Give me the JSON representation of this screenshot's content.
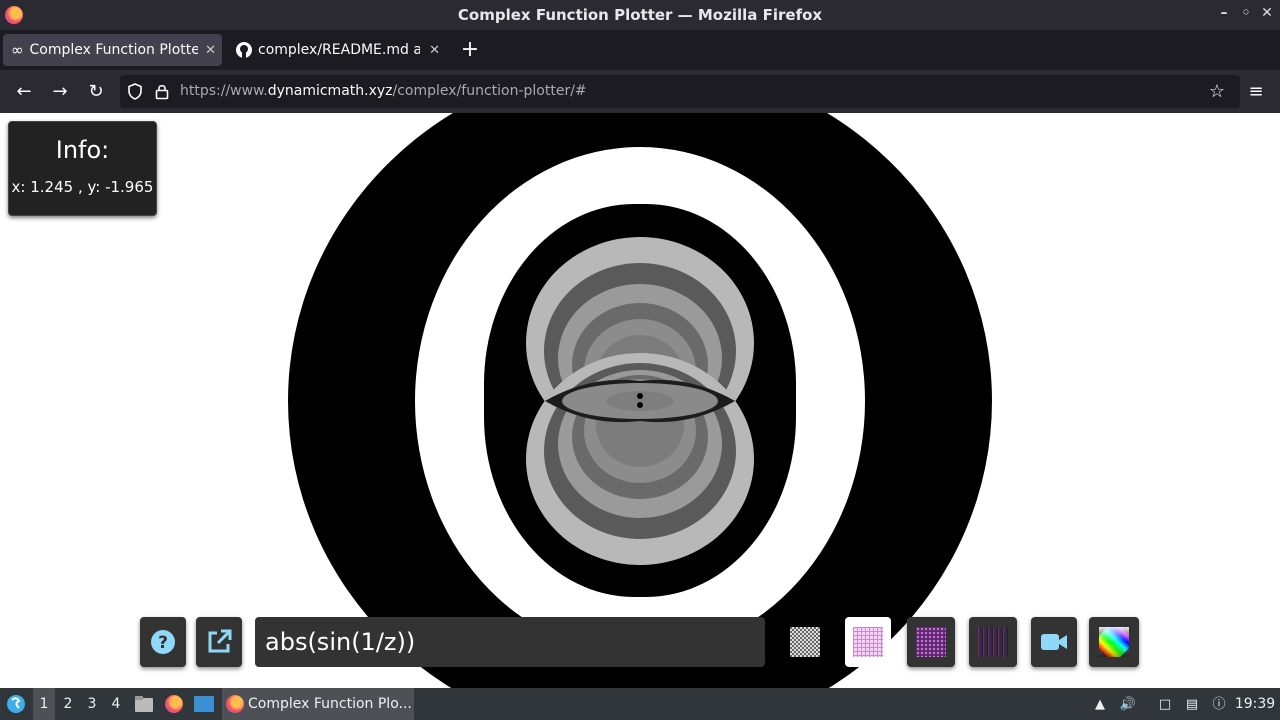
{
  "window": {
    "title": "Complex Function Plotter — Mozilla Firefox",
    "controls": [
      "minimize",
      "maximize",
      "close"
    ]
  },
  "tabs": [
    {
      "label": "Complex Function Plotter",
      "active": true,
      "icon": "infinity-icon"
    },
    {
      "label": "complex/README.md at",
      "active": false,
      "icon": "github-icon"
    }
  ],
  "navbar": {
    "url_prefix": "https://www.",
    "url_host": "dynamicmath.xyz",
    "url_path": "/complex/function-plotter/#"
  },
  "info": {
    "title": "Info:",
    "coords": "x: 1.245 , y: -1.965"
  },
  "toolbar": {
    "function": "abs(sin(1/z))",
    "help_icon": "question-icon",
    "share_icon": "external-link-icon",
    "camera_icon": "video-camera-icon",
    "colors": {
      "accent": "#333333",
      "help": "#8fd8f8"
    }
  },
  "taskbar": {
    "workspaces": [
      "1",
      "2",
      "3",
      "4"
    ],
    "active_workspace": "1",
    "window_label": "Complex Function Plo...",
    "clock": "19:39"
  }
}
